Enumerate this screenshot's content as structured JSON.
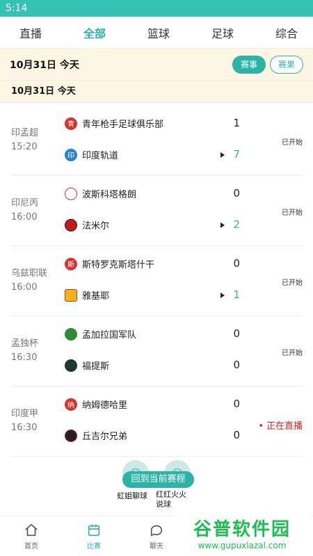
{
  "status_bar": {
    "time": "5:14"
  },
  "top_tabs": [
    {
      "label": "直播"
    },
    {
      "label": "全部",
      "active": true
    },
    {
      "label": "篮球"
    },
    {
      "label": "足球"
    },
    {
      "label": "综合"
    }
  ],
  "date_bar": {
    "date": "10月31日  今天",
    "schedule_btn": "赛事",
    "results_btn": "赛果"
  },
  "sub_date": "10月31日    今天",
  "matches": [
    {
      "league": "印孟超",
      "time": "15:20",
      "home": {
        "name": "青年枪手足球俱乐部",
        "logo": "青"
      },
      "away": {
        "name": "印度轨道",
        "logo": "印"
      },
      "home_score": "1",
      "away_score": "7",
      "status": "已开始"
    },
    {
      "league": "印尼丙",
      "time": "16:00",
      "home": {
        "name": "波斯科塔格朗",
        "logo": ""
      },
      "away": {
        "name": "法米尔",
        "logo": ""
      },
      "home_score": "0",
      "away_score": "2",
      "status": "已开始"
    },
    {
      "league": "乌兹职联",
      "time": "16:00",
      "home": {
        "name": "斯特罗克斯塔什干",
        "logo": "斯"
      },
      "away": {
        "name": "雅基耶",
        "logo": ""
      },
      "home_score": "0",
      "away_score": "1",
      "status": "已开始"
    },
    {
      "league": "孟独杯",
      "time": "16:30",
      "home": {
        "name": "孟加拉国军队",
        "logo": ""
      },
      "away": {
        "name": "福提斯",
        "logo": ""
      },
      "home_score": "0",
      "away_score": "0",
      "status": "已开始"
    },
    {
      "league": "印度甲",
      "time": "16:30",
      "home": {
        "name": "纳姆德哈里",
        "logo": "纳"
      },
      "away": {
        "name": "丘吉尔兄弟",
        "logo": ""
      },
      "home_score": "0",
      "away_score": "0",
      "status": "正在直播"
    }
  ],
  "floating": {
    "back_label": "回到当前赛程",
    "anchor1": "虹姐聊球",
    "anchor2": "红红火火说球"
  },
  "bottom_nav": [
    {
      "label": "首页",
      "icon": "home-icon"
    },
    {
      "label": "比赛",
      "icon": "calendar-icon",
      "active": true
    },
    {
      "label": "聊天",
      "icon": "chat-icon"
    }
  ],
  "watermark": {
    "title": "谷普软件园",
    "url": "www.gupuxlazal.com"
  },
  "colors": {
    "accent": "#2bb3a6",
    "live": "#e02020",
    "statusbar": "#33c2b3"
  }
}
